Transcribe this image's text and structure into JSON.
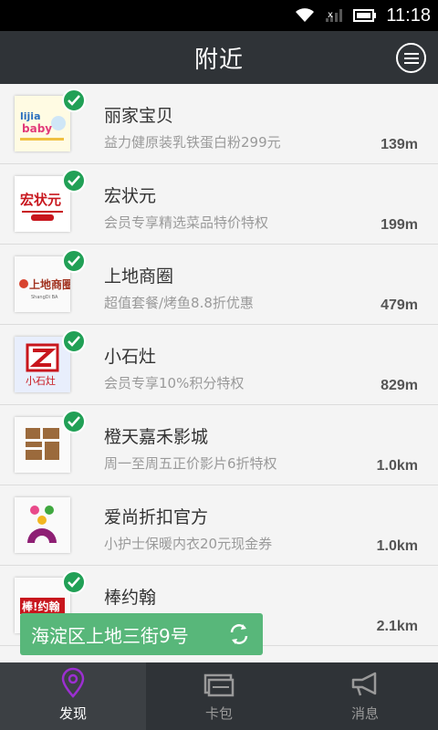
{
  "status": {
    "time": "11:18"
  },
  "header": {
    "title": "附近"
  },
  "stores": [
    {
      "name": "丽家宝贝",
      "desc": "益力健原装乳铁蛋白粉299元",
      "dist": "139m",
      "logo": "lijiababy-logo",
      "logo_text": "lijia baby",
      "verified": true
    },
    {
      "name": "宏状元",
      "desc": "会员专享精选菜品特价特权",
      "dist": "199m",
      "logo": "hongzhuangyuan-logo",
      "logo_text": "宏状元",
      "verified": true
    },
    {
      "name": "上地商圈",
      "desc": "超值套餐/烤鱼8.8折优惠",
      "dist": "479m",
      "logo": "shangdi-logo",
      "logo_text": "上地商圈",
      "verified": true
    },
    {
      "name": "小石灶",
      "desc": "会员专享10%积分特权",
      "dist": "829m",
      "logo": "xiaoshizao-logo",
      "logo_text": "小石灶",
      "verified": true
    },
    {
      "name": "橙天嘉禾影城",
      "desc": "周一至周五正价影片6折特权",
      "dist": "1.0km",
      "logo": "orange-sky-logo",
      "logo_text": "",
      "verified": true
    },
    {
      "name": "爱尚折扣官方",
      "desc": "小护士保暖内衣20元现金券",
      "dist": "1.0km",
      "logo": "aishang-logo",
      "logo_text": "",
      "verified": false
    },
    {
      "name": "棒约翰",
      "desc": "",
      "dist": "2.1km",
      "logo": "papajohns-logo",
      "logo_text": "棒!约翰",
      "verified": true
    }
  ],
  "location_toast": {
    "address": "海淀区上地三街9号"
  },
  "tabs": [
    {
      "label": "发现",
      "icon": "location-pin-icon",
      "active": true
    },
    {
      "label": "卡包",
      "icon": "card-wallet-icon",
      "active": false
    },
    {
      "label": "消息",
      "icon": "megaphone-icon",
      "active": false
    }
  ],
  "colors": {
    "accent_green": "#21a056",
    "toast_green": "#58b77a",
    "header_bg": "#2f3337",
    "active_tab_icon": "#9c2fd1"
  }
}
